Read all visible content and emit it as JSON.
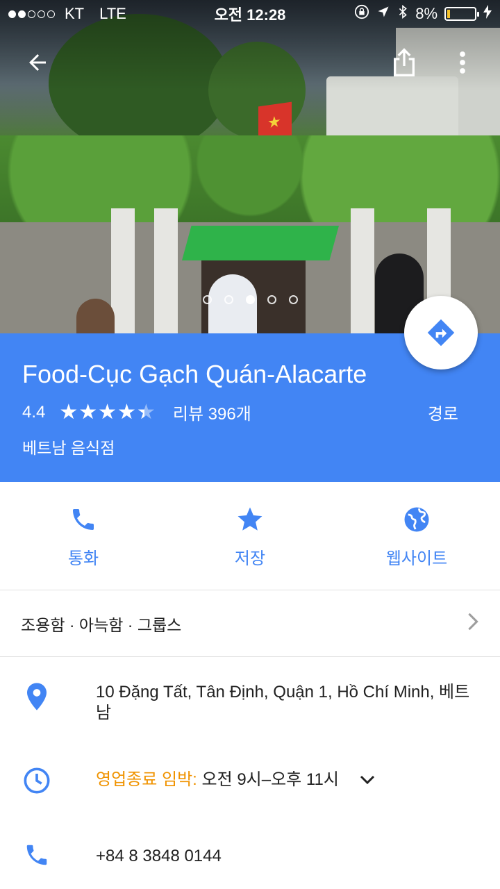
{
  "status_bar": {
    "signal_dots": 5,
    "signal_filled": 2,
    "carrier": "KT",
    "network": "LTE",
    "time": "오전 12:28",
    "battery": "8%",
    "battery_level": 0.08
  },
  "hero": {
    "photo_count": 5,
    "active_photo_index": 2
  },
  "place": {
    "name": "Food-Cục Gạch Quán-Alacarte",
    "rating": "4.4",
    "rating_fraction": 0.88,
    "reviews": "리뷰 396개",
    "category": "베트남 음식점",
    "route_label": "경로"
  },
  "actions": [
    {
      "label": "통화",
      "icon": "phone-icon"
    },
    {
      "label": "저장",
      "icon": "star-icon"
    },
    {
      "label": "웹사이트",
      "icon": "globe-icon"
    }
  ],
  "tags": "조용함 · 아늑함 · 그룹스",
  "details": {
    "address": "10 Đặng Tất, Tân Định, Quận 1, Hồ Chí Minh, 베트남",
    "hours_status": "영업종료 임박:",
    "hours": " 오전 9시–오후 11시",
    "phone": "+84 8 3848 0144"
  },
  "colors": {
    "accent": "#4285f4",
    "warning": "#f09300"
  }
}
